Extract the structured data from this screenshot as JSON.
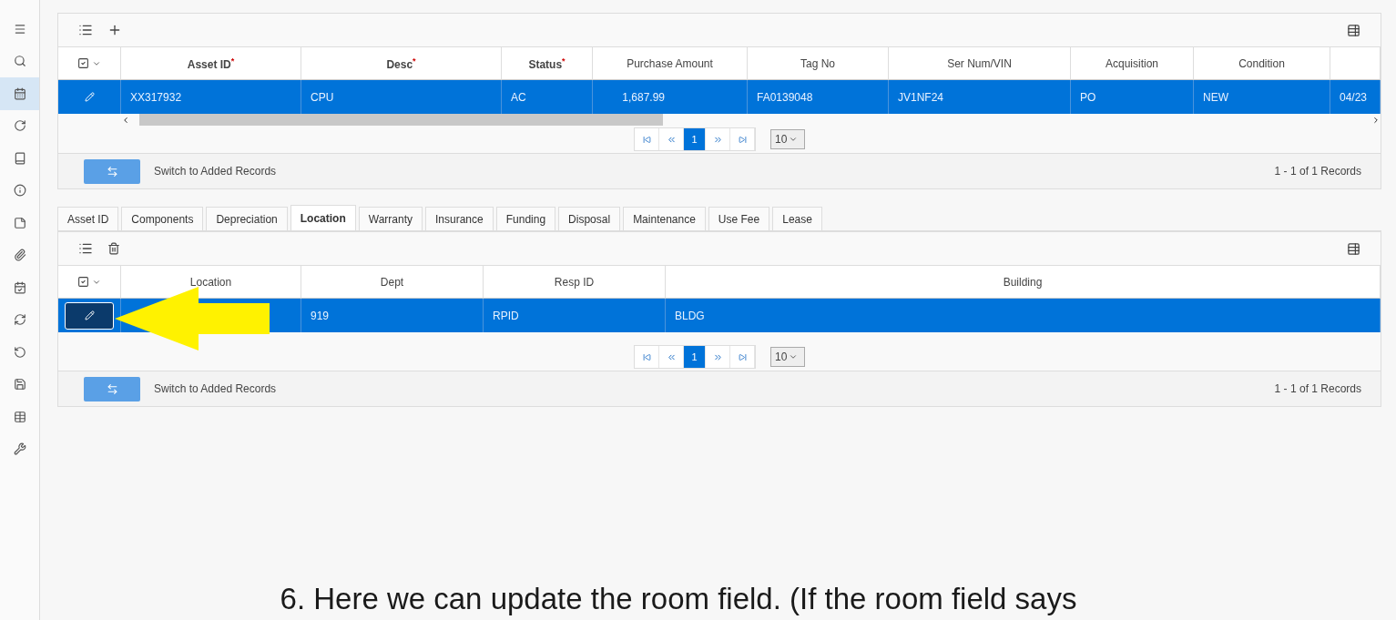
{
  "sidebar": {
    "items": [
      {
        "selected": false
      },
      {
        "selected": false
      },
      {
        "selected": true
      },
      {
        "selected": false
      },
      {
        "selected": false
      },
      {
        "selected": false
      },
      {
        "selected": false
      },
      {
        "selected": false
      },
      {
        "selected": false
      },
      {
        "selected": false
      },
      {
        "selected": false
      },
      {
        "selected": false
      },
      {
        "selected": false
      },
      {
        "selected": false
      }
    ]
  },
  "asset_grid": {
    "columns": [
      {
        "label": "Asset ID$^{*}$",
        "required": true
      },
      {
        "label": "Desc$^{*}$",
        "required": true
      },
      {
        "label": "Status$^{*}$",
        "required": true
      },
      {
        "label": "Purchase Amount",
        "required": false
      },
      {
        "label": "Tag No",
        "required": false
      },
      {
        "label": "Ser Num/VIN",
        "required": false
      },
      {
        "label": "Acquisition",
        "required": false
      },
      {
        "label": "Condition",
        "required": false
      },
      {}
    ],
    "rows": [
      {
        "selected": true,
        "focused": false,
        "cells": [
          "XX317932",
          "CPU",
          "AC",
          "1,687.99",
          "FA0139048",
          "JV1NF24",
          "PO",
          "NEW",
          "04/23"
        ]
      }
    ],
    "scrollbar": true,
    "pager": {
      "page": "1",
      "page_size": "10"
    },
    "switch_label": "Switch to Added Records",
    "records": "1 - 1 of 1 Records"
  },
  "tabs": [
    {
      "label": "Asset ID",
      "selected": false
    },
    {
      "label": "Components",
      "selected": false
    },
    {
      "label": "Depreciation",
      "selected": false
    },
    {
      "label": "Location",
      "selected": true
    },
    {
      "label": "Warranty",
      "selected": false
    },
    {
      "label": "Insurance",
      "selected": false
    },
    {
      "label": "Funding",
      "selected": false
    },
    {
      "label": "Disposal",
      "selected": false
    },
    {
      "label": "Maintenance",
      "selected": false
    },
    {
      "label": "Use Fee",
      "selected": false
    },
    {
      "label": "Lease",
      "selected": false
    }
  ],
  "location_grid": {
    "columns": [
      {
        "label": "Location",
        "required": false
      },
      {
        "label": "Dept",
        "required": false
      },
      {
        "label": "Resp ID",
        "required": false
      },
      {
        "label": "Building",
        "required": false
      }
    ],
    "rows": [
      {
        "selected": true,
        "focused": true,
        "cells": [
          null,
          "919",
          "RPID",
          "BLDG"
        ]
      }
    ],
    "pager": {
      "page": "1",
      "page_size": "10"
    },
    "switch_label": "Switch to Added Records",
    "records": "1 - 1 of 1 Records"
  },
  "caption": "6. Here we can update the room field. (If the room field says"
}
